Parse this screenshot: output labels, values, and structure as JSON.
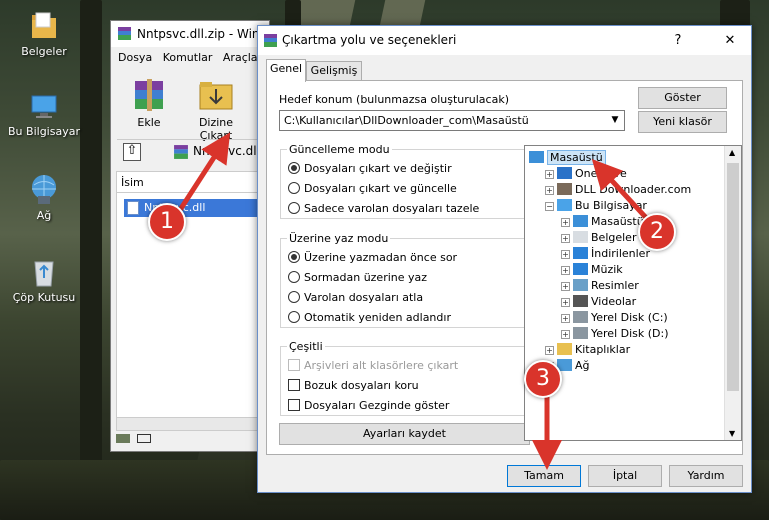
{
  "desktop": {
    "icons": [
      {
        "label": "Belgeler",
        "icon": "folder-icon"
      },
      {
        "label": "Bu Bilgisayar",
        "icon": "computer-icon"
      },
      {
        "label": "Ağ",
        "icon": "network-icon"
      },
      {
        "label": "Çöp Kutusu",
        "icon": "recycle-bin-icon"
      }
    ]
  },
  "winrar": {
    "title": "Nntpsvc.dll.zip - WinRAR",
    "menu": [
      "Dosya",
      "Komutlar",
      "Araçlar"
    ],
    "toolbar": {
      "add_label": "Ekle",
      "extract_label": "Dizine Çıkart"
    },
    "address": "Nntpsvc.dll",
    "column_name": "İsim",
    "file": "Nntpsvc.dll"
  },
  "dialog": {
    "title": "Çıkartma yolu ve seçenekleri",
    "tabs": [
      "Genel",
      "Gelişmiş"
    ],
    "dest_label": "Hedef konum (bulunmazsa oluşturulacak)",
    "dest_path": "C:\\Kullanıcılar\\DllDownloader_com\\Masaüstü",
    "show_button": "Göster",
    "new_folder_button": "Yeni klasör",
    "update_group": {
      "title": "Güncelleme modu",
      "options": [
        "Dosyaları çıkart ve değiştir",
        "Dosyaları çıkart ve güncelle",
        "Sadece varolan dosyaları tazele"
      ],
      "selected": 0
    },
    "overwrite_group": {
      "title": "Üzerine yaz modu",
      "options": [
        "Üzerine yazmadan önce sor",
        "Sormadan üzerine yaz",
        "Varolan dosyaları atla",
        "Otomatik yeniden adlandır"
      ],
      "selected": 0
    },
    "misc_group": {
      "title": "Çeşitli",
      "options": [
        "Arşivleri alt klasörlere çıkart",
        "Bozuk dosyaları koru",
        "Dosyaları Gezginde göster"
      ]
    },
    "save_settings_button": "Ayarları kaydet",
    "tree": [
      {
        "label": "Masaüstü",
        "icon": "desktop-icon",
        "level": 0,
        "expander": "",
        "selected": true
      },
      {
        "label": "OneDrive",
        "icon": "cloud-icon",
        "level": 1,
        "expander": "+",
        "selected": false
      },
      {
        "label": "DLL Downloader.com",
        "icon": "user-icon",
        "level": 1,
        "expander": "+",
        "selected": false
      },
      {
        "label": "Bu Bilgisayar",
        "icon": "computer-icon",
        "level": 1,
        "expander": "−",
        "selected": false
      },
      {
        "label": "Masaüstü",
        "icon": "desktop-icon",
        "level": 2,
        "expander": "+",
        "selected": false
      },
      {
        "label": "Belgeler",
        "icon": "document-icon",
        "level": 2,
        "expander": "+",
        "selected": false
      },
      {
        "label": "İndirilenler",
        "icon": "download-icon",
        "level": 2,
        "expander": "+",
        "selected": false
      },
      {
        "label": "Müzik",
        "icon": "music-icon",
        "level": 2,
        "expander": "+",
        "selected": false
      },
      {
        "label": "Resimler",
        "icon": "pictures-icon",
        "level": 2,
        "expander": "+",
        "selected": false
      },
      {
        "label": "Videolar",
        "icon": "video-icon",
        "level": 2,
        "expander": "+",
        "selected": false
      },
      {
        "label": "Yerel Disk (C:)",
        "icon": "disk-icon",
        "level": 2,
        "expander": "+",
        "selected": false
      },
      {
        "label": "Yerel Disk (D:)",
        "icon": "disk-icon",
        "level": 2,
        "expander": "+",
        "selected": false
      },
      {
        "label": "Kitaplıklar",
        "icon": "library-icon",
        "level": 1,
        "expander": "+",
        "selected": false
      },
      {
        "label": "Ağ",
        "icon": "network-icon",
        "level": 1,
        "expander": "+",
        "selected": false
      }
    ],
    "ok_button": "Tamam",
    "cancel_button": "İptal",
    "help_button": "Yardım",
    "help_title_button": "?",
    "close_title_button": "✕"
  },
  "callouts": [
    "1",
    "2",
    "3"
  ],
  "colors": {
    "callout": "#d9342b",
    "selection": "#3b78d8",
    "tree_selection": "#cce4f7"
  }
}
